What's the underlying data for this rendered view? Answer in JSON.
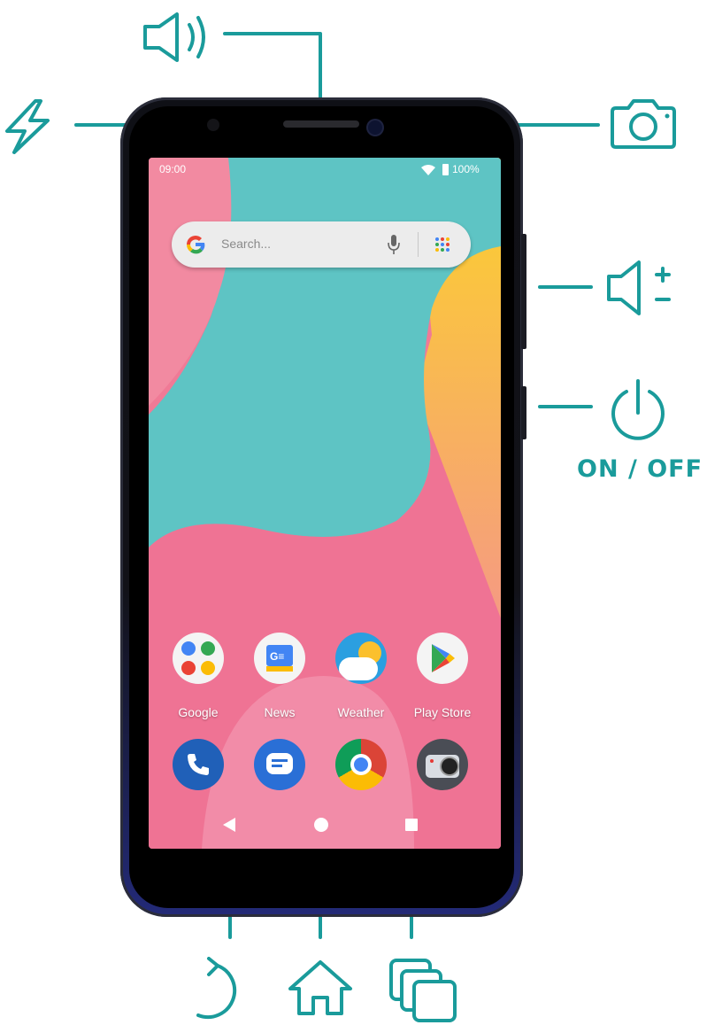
{
  "status_bar": {
    "time": "09:00",
    "battery": "100%"
  },
  "search": {
    "placeholder": "Search..."
  },
  "apps_row": [
    {
      "label": "Google",
      "icon": "google-folder-icon"
    },
    {
      "label": "News",
      "icon": "news-icon"
    },
    {
      "label": "Weather",
      "icon": "weather-icon"
    },
    {
      "label": "Play Store",
      "icon": "play-store-icon"
    }
  ],
  "dock": [
    {
      "icon": "phone-icon"
    },
    {
      "icon": "messages-icon"
    },
    {
      "icon": "chrome-icon"
    },
    {
      "icon": "camera-app-icon"
    }
  ],
  "nav_bar": [
    "back-icon",
    "home-icon",
    "recents-icon"
  ],
  "callouts": {
    "power_label": "ON / OFF",
    "icons": [
      "speaker-icon",
      "flash-icon",
      "camera-icon",
      "volume-rocker-icon",
      "power-icon",
      "back-arrow-icon",
      "house-icon",
      "multitask-icon"
    ]
  },
  "colors": {
    "accent": "#1a9b9b",
    "wallpaper_teal": "#5ec4c4",
    "wallpaper_pink": "#f07a96",
    "wallpaper_yellow": "#f9c84a"
  }
}
